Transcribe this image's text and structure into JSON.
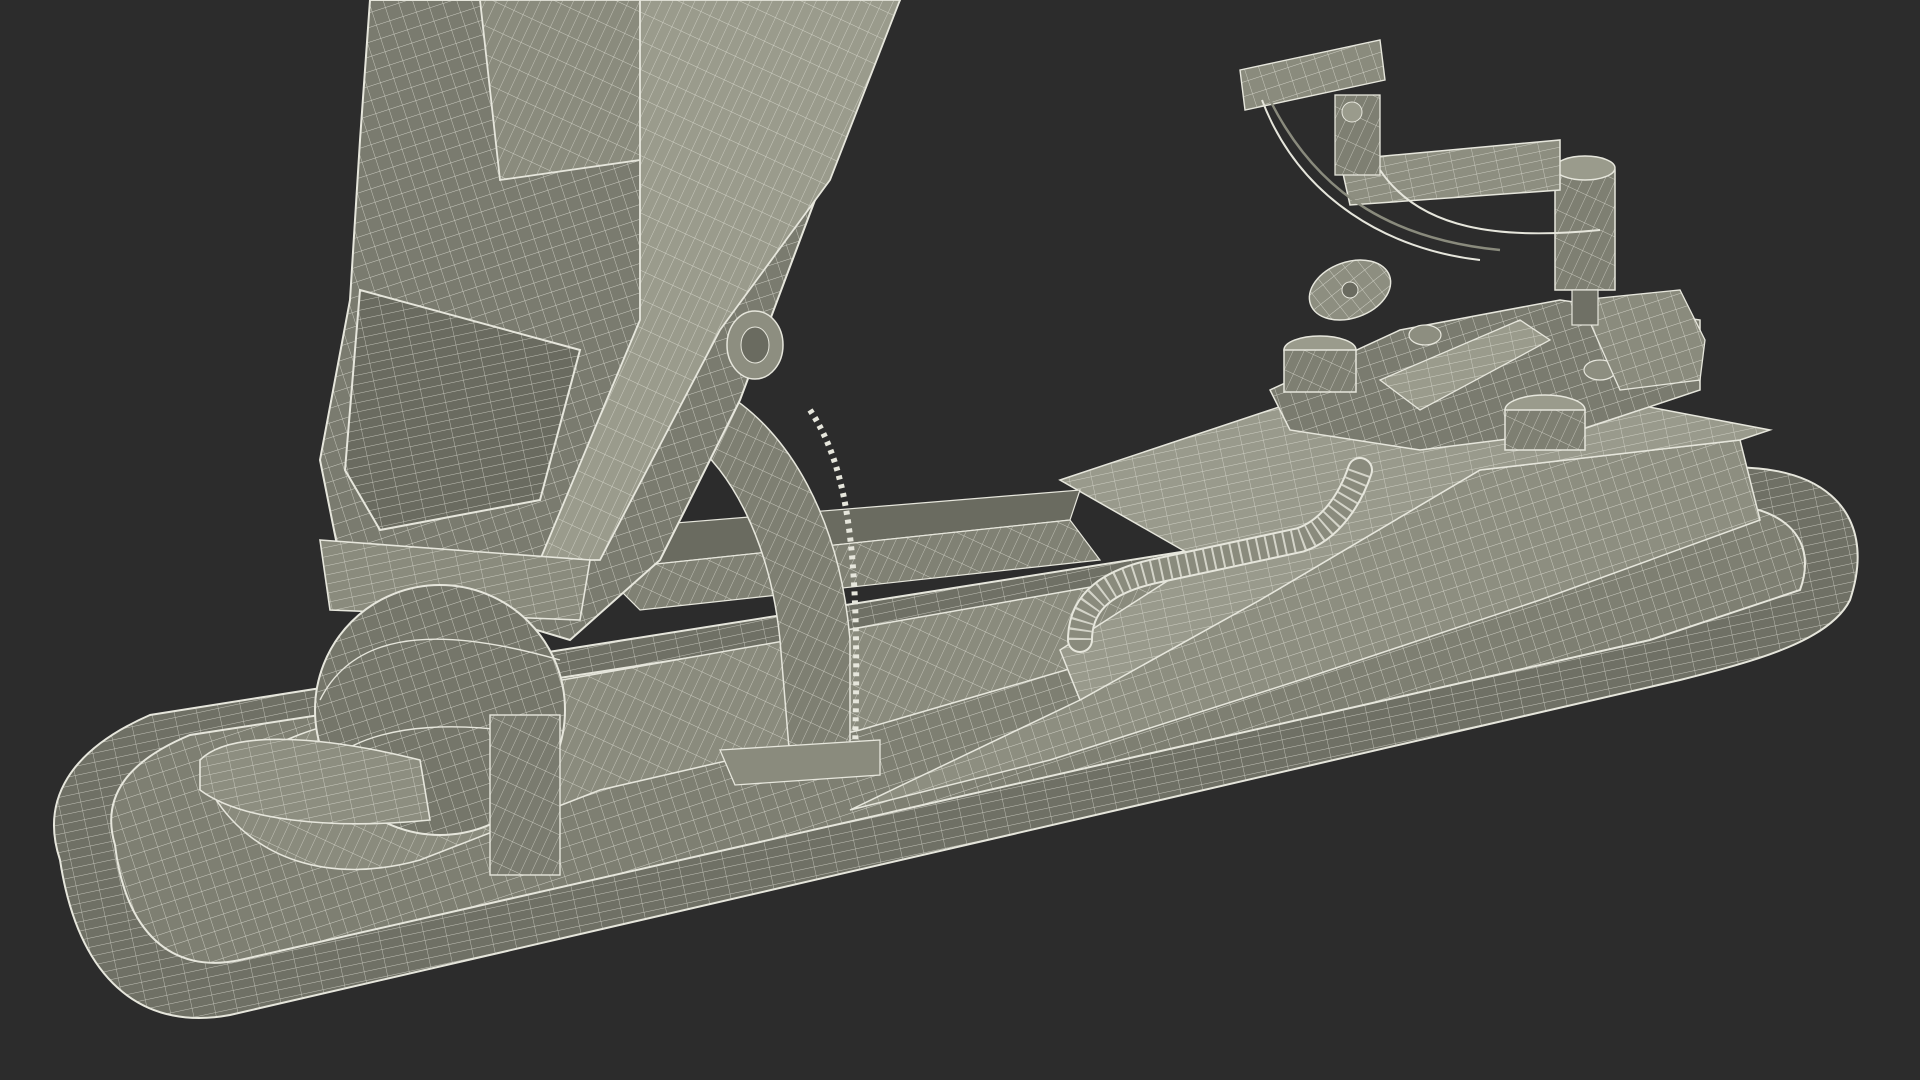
{
  "scene": {
    "background": "#2c2c2c",
    "mesh_fill": "#7e7f72",
    "mesh_fill_dark": "#5f6055",
    "mesh_fill_light": "#9a9b8c",
    "wire_color": "#e6e6dc",
    "subject": "wireframe-render-mech-leg-on-base"
  }
}
